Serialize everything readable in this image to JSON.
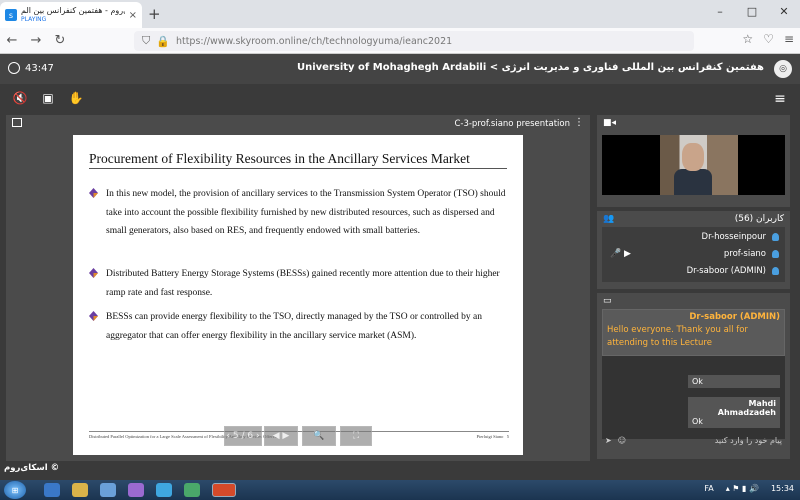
{
  "browser": {
    "tab_title": "اسکای‌روم - هفتمین کنفرانس بین الم",
    "tab_status": "PLAYING",
    "tab_close": "×",
    "new_tab": "+",
    "window_controls": [
      "–",
      "□",
      "✕"
    ],
    "url": "https://www.skyroom.online/ch/technologyuma/ieanc2021",
    "icons": [
      "back-icon",
      "forward-icon",
      "reload-icon",
      "shield-icon",
      "lock-icon",
      "star-icon",
      "pocket-icon",
      "menu-icon"
    ]
  },
  "header": {
    "timer": "43:47",
    "room_title": "University of Mohaghegh Ardabili < هفتمین کنفرانس بین المللی فناوری و مدیریت انرژی"
  },
  "toolbar": {
    "icons": [
      "mute-mic-icon",
      "screen-icon",
      "raise-hand-icon",
      "hamburger-menu-icon"
    ]
  },
  "presentation": {
    "title": "C-3-prof.siano presentation",
    "menu_icon": "⋮",
    "slide": {
      "heading": "Procurement of Flexibility Resources in the Ancillary Services Market",
      "bullets": [
        "In this new model, the provision of ancillary services to the Transmission System Operator (TSO) should take into account the possible flexibility furnished by new distributed resources, such as dispersed and small generators, also based on RES, and frequently endowed with small batteries.",
        "Distributed Battery Energy Storage Systems (BESSs) gained recently more attention due to their higher ramp rate and fast response.",
        "BESSs can provide energy flexibility to the TSO, directly managed by the TSO or controlled by an aggregator that can offer energy flexibility in the ancillary service market (ASM)."
      ],
      "footer_left": "Distributed Parallel Optimization for a Large Scale Assessment of Flexibility Ancillary Services Offered",
      "footer_right": "Pierluigi Siano",
      "page_number": "5"
    },
    "controls": [
      "‹ 5 / 6 ›",
      "◀ ▶",
      "🔍",
      "⛶"
    ]
  },
  "video_panel": {
    "icon": "camera-icon"
  },
  "users_panel": {
    "title": "کاربران (56)",
    "users": [
      {
        "name": "Dr-hosseinpour"
      },
      {
        "name": "prof-siano"
      },
      {
        "name": "Dr-saboor (ADMIN)"
      }
    ]
  },
  "chat_panel": {
    "highlight": {
      "author": "Dr-saboor (ADMIN)",
      "message": "Hello everyone. Thank you all for attending to this Lecture"
    },
    "messages": [
      {
        "author": "",
        "text": "Ok"
      },
      {
        "author": "Mahdi Ahmadzadeh",
        "text": "Ok"
      }
    ],
    "input_placeholder": "پیام خود را وارد کنید"
  },
  "brand": "اسکای‌روم ©",
  "taskbar": {
    "lang": "FA",
    "time": "15:34"
  }
}
